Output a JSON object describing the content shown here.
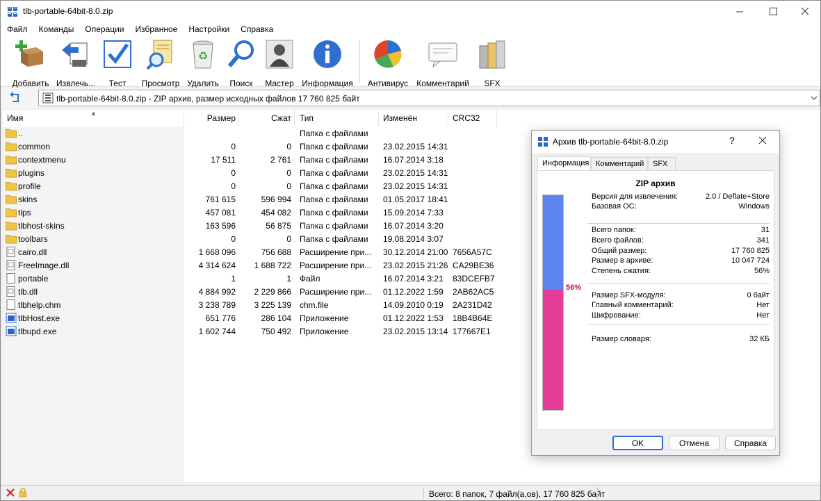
{
  "window": {
    "title": "tlb-portable-64bit-8.0.zip"
  },
  "menu": [
    "Файл",
    "Команды",
    "Операции",
    "Избранное",
    "Настройки",
    "Справка"
  ],
  "toolbar": {
    "add": "Добавить",
    "extract": "Извлечь...",
    "test": "Тест",
    "view": "Просмотр",
    "delete": "Удалить",
    "find": "Поиск",
    "wizard": "Мастер",
    "info": "Информация",
    "antivirus": "Антивирус",
    "comment": "Комментарий",
    "sfx": "SFX"
  },
  "address": {
    "text": "tlb-portable-64bit-8.0.zip - ZIP архив, размер исходных файлов 17 760 825 байт"
  },
  "columns": {
    "name": "Имя",
    "size": "Размер",
    "packed": "Сжат",
    "type": "Тип",
    "modified": "Изменён",
    "crc": "CRC32"
  },
  "files": [
    {
      "icon": "folder",
      "name": "..",
      "size": "",
      "packed": "",
      "type": "Папка с файлами",
      "modified": "",
      "crc": ""
    },
    {
      "icon": "folder",
      "name": "common",
      "size": "0",
      "packed": "0",
      "type": "Папка с файлами",
      "modified": "23.02.2015 14:31",
      "crc": ""
    },
    {
      "icon": "folder",
      "name": "contextmenu",
      "size": "17 511",
      "packed": "2 761",
      "type": "Папка с файлами",
      "modified": "16.07.2014 3:18",
      "crc": ""
    },
    {
      "icon": "folder",
      "name": "plugins",
      "size": "0",
      "packed": "0",
      "type": "Папка с файлами",
      "modified": "23.02.2015 14:31",
      "crc": ""
    },
    {
      "icon": "folder",
      "name": "profile",
      "size": "0",
      "packed": "0",
      "type": "Папка с файлами",
      "modified": "23.02.2015 14:31",
      "crc": ""
    },
    {
      "icon": "folder",
      "name": "skins",
      "size": "761 615",
      "packed": "596 994",
      "type": "Папка с файлами",
      "modified": "01.05.2017 18:41",
      "crc": ""
    },
    {
      "icon": "folder",
      "name": "tips",
      "size": "457 081",
      "packed": "454 082",
      "type": "Папка с файлами",
      "modified": "15.09.2014 7:33",
      "crc": ""
    },
    {
      "icon": "folder",
      "name": "tlbhost-skins",
      "size": "163 596",
      "packed": "56 875",
      "type": "Папка с файлами",
      "modified": "16.07.2014 3:20",
      "crc": ""
    },
    {
      "icon": "folder",
      "name": "toolbars",
      "size": "0",
      "packed": "0",
      "type": "Папка с файлами",
      "modified": "19.08.2014 3:07",
      "crc": ""
    },
    {
      "icon": "dll",
      "name": "cairo.dll",
      "size": "1 668 096",
      "packed": "756 688",
      "type": "Расширение при...",
      "modified": "30.12.2014 21:00",
      "crc": "7656A57C"
    },
    {
      "icon": "dll",
      "name": "FreeImage.dll",
      "size": "4 314 624",
      "packed": "1 688 722",
      "type": "Расширение при...",
      "modified": "23.02.2015 21:26",
      "crc": "CA29BE36"
    },
    {
      "icon": "file",
      "name": "portable",
      "size": "1",
      "packed": "1",
      "type": "Файл",
      "modified": "16.07.2014 3:21",
      "crc": "83DCEFB7"
    },
    {
      "icon": "dll",
      "name": "tlb.dll",
      "size": "4 884 992",
      "packed": "2 229 866",
      "type": "Расширение при...",
      "modified": "01.12.2022 1:59",
      "crc": "2AB62AC5"
    },
    {
      "icon": "file",
      "name": "tlbhelp.chm",
      "size": "3 238 789",
      "packed": "3 225 139",
      "type": "chm.file",
      "modified": "14.09.2010 0:19",
      "crc": "2A231D42"
    },
    {
      "icon": "exe",
      "name": "tlbHost.exe",
      "size": "651 776",
      "packed": "286 104",
      "type": "Приложение",
      "modified": "01.12.2022 1:53",
      "crc": "18B4B64E"
    },
    {
      "icon": "exe",
      "name": "tlbupd.exe",
      "size": "1 602 744",
      "packed": "750 492",
      "type": "Приложение",
      "modified": "23.02.2015 13:14",
      "crc": "177667E1"
    }
  ],
  "status": {
    "text": "Всего: 8 папок, 7 файл(а,ов), 17 760 825 байт"
  },
  "dialog": {
    "title": "Архив tlb-portable-64bit-8.0.zip",
    "help": "?",
    "tabs": [
      "Информация",
      "Комментарий",
      "SFX"
    ],
    "heading": "ZIP архив",
    "ratio_percent": 56,
    "ratio_label": "56%",
    "rows": [
      {
        "k": "Версия для извлечения:",
        "v": "2.0 / Deflate+Store"
      },
      {
        "k": "Базовая ОС:",
        "v": "Windows"
      },
      {
        "k": "Всего папок:",
        "v": "31"
      },
      {
        "k": "Всего файлов:",
        "v": "341"
      },
      {
        "k": "Общий размер:",
        "v": "17 760 825"
      },
      {
        "k": "Размер в архиве:",
        "v": "10 047 724"
      },
      {
        "k": "Степень сжатия:",
        "v": "56%"
      },
      {
        "k": "Размер SFX-модуля:",
        "v": "0 байт"
      },
      {
        "k": "Главный комментарий:",
        "v": "Нет"
      },
      {
        "k": "Шифрование:",
        "v": "Нет"
      },
      {
        "k": "Размер словаря:",
        "v": "32 КБ"
      }
    ],
    "buttons": {
      "ok": "OK",
      "cancel": "Отмена",
      "help": "Справка"
    }
  },
  "colors": {
    "bar_top": "#5b84ee",
    "bar_bottom": "#e43d98",
    "folder": "#f2c443"
  }
}
